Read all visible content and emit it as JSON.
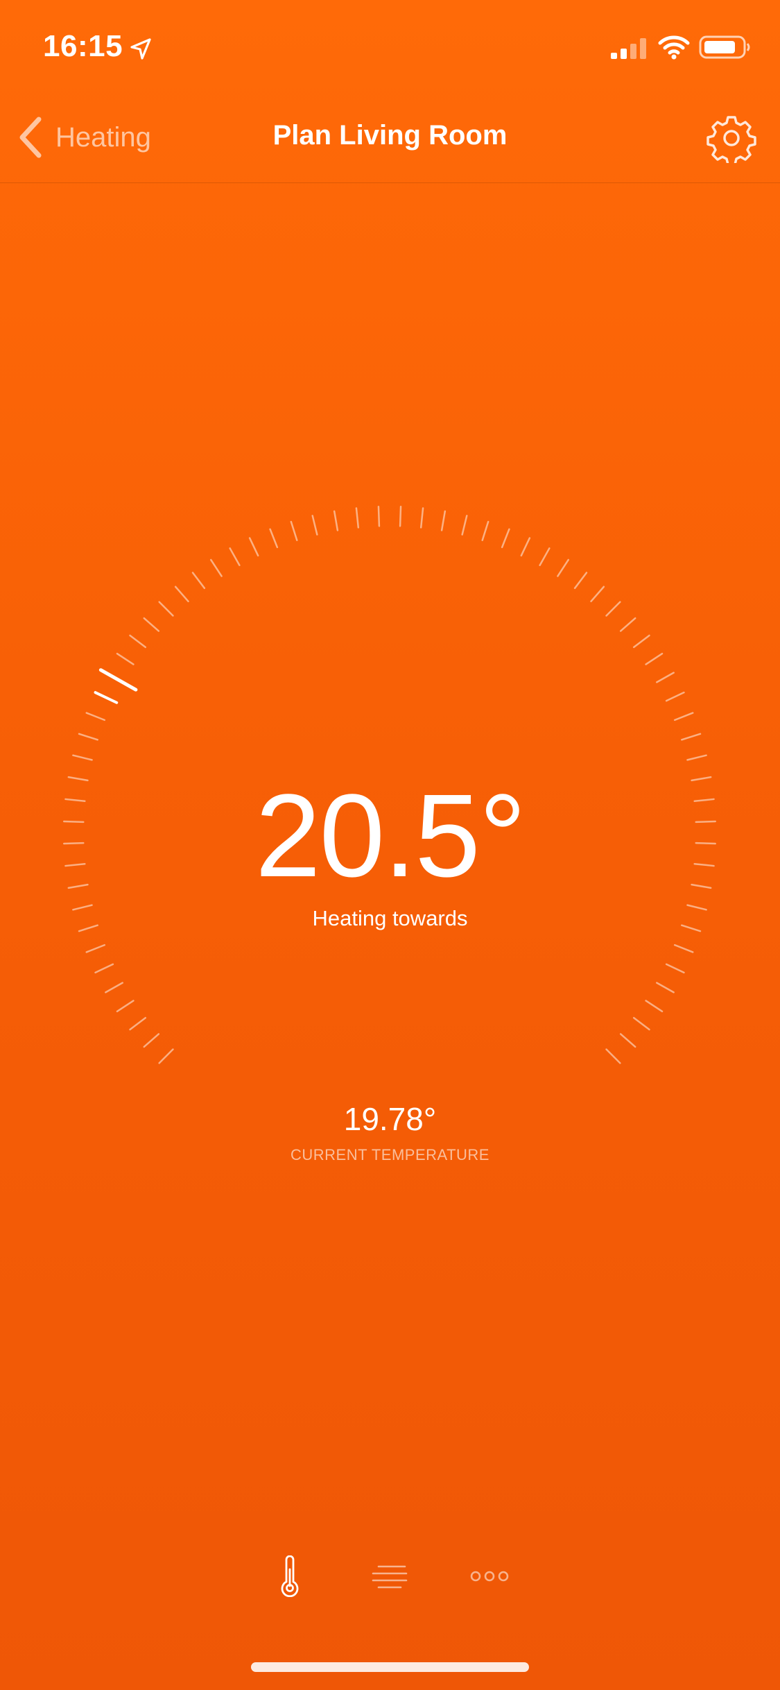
{
  "status_bar": {
    "time": "16:15",
    "location_icon": "location-arrow-icon",
    "signal_icon": "cellular-signal-icon",
    "wifi_icon": "wifi-icon",
    "battery_icon": "battery-icon"
  },
  "nav": {
    "back_label": "Heating",
    "back_icon": "chevron-left-icon",
    "title": "Plan Living Room",
    "settings_icon": "gear-icon"
  },
  "dial": {
    "target_value": "20.5°",
    "target_label": "Heating towards",
    "current_value": "19.78°",
    "current_label": "CURRENT TEMPERATURE"
  },
  "tabs": [
    {
      "icon": "thermometer-icon",
      "active": true
    },
    {
      "icon": "list-lines-icon",
      "active": false
    },
    {
      "icon": "more-dots-icon",
      "active": false
    }
  ],
  "colors": {
    "background_top": "#ff6a08",
    "background_bottom": "#ef5706",
    "foreground": "#ffffff"
  }
}
